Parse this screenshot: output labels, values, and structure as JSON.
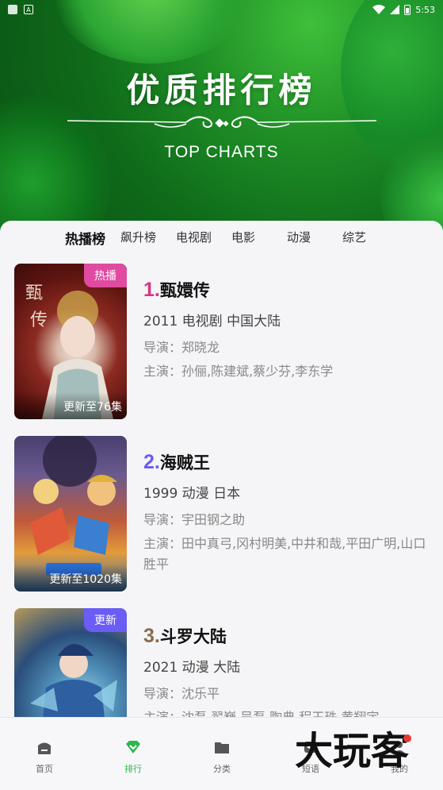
{
  "status_bar": {
    "time": "5:53"
  },
  "hero": {
    "title": "优质排行榜",
    "subtitle": "TOP CHARTS"
  },
  "tabs": [
    {
      "label": "热播榜",
      "active": true
    },
    {
      "label": "飙升榜",
      "active": false
    },
    {
      "label": "电视剧",
      "active": false
    },
    {
      "label": "电影",
      "active": false
    },
    {
      "label": "动漫",
      "active": false
    },
    {
      "label": "综艺",
      "active": false
    }
  ],
  "items": [
    {
      "rank": "1.",
      "rank_color": "#d63384",
      "title": "甄嬛传",
      "meta": "2011  电视剧  中国大陆",
      "director": "导演：郑晓龙",
      "cast": "主演：孙俪,陈建斌,蔡少芬,李东学",
      "badge": "热播",
      "badge_color": "#e04aa0",
      "update": "更新至76集"
    },
    {
      "rank": "2.",
      "rank_color": "#6a5cf5",
      "title": "海贼王",
      "meta": "1999  动漫  日本",
      "director": "导演：宇田钢之助",
      "cast": "主演：田中真弓,冈村明美,中井和哉,平田广明,山口胜平",
      "badge": "",
      "update": "更新至1020集"
    },
    {
      "rank": "3.",
      "rank_color": "#8a6a4a",
      "title": "斗罗大陆",
      "meta": "2021  动漫  大陆",
      "director": "导演：沈乐平",
      "cast": "主演：沈磊,翟巍,吴磊,陶典,程玉珠,黄翔宇",
      "badge": "更新",
      "badge_color": "#6a5cf5",
      "update": ""
    }
  ],
  "bottom_nav": [
    {
      "label": "首页",
      "active": false,
      "icon": "home-icon"
    },
    {
      "label": "排行",
      "active": true,
      "icon": "ranking-icon"
    },
    {
      "label": "分类",
      "active": false,
      "icon": "folder-icon"
    },
    {
      "label": "短语",
      "active": false,
      "icon": "share-icon"
    },
    {
      "label": "我的",
      "active": false,
      "icon": "profile-icon"
    }
  ],
  "watermark": "大玩客",
  "colors": {
    "accent": "#2db84d"
  }
}
